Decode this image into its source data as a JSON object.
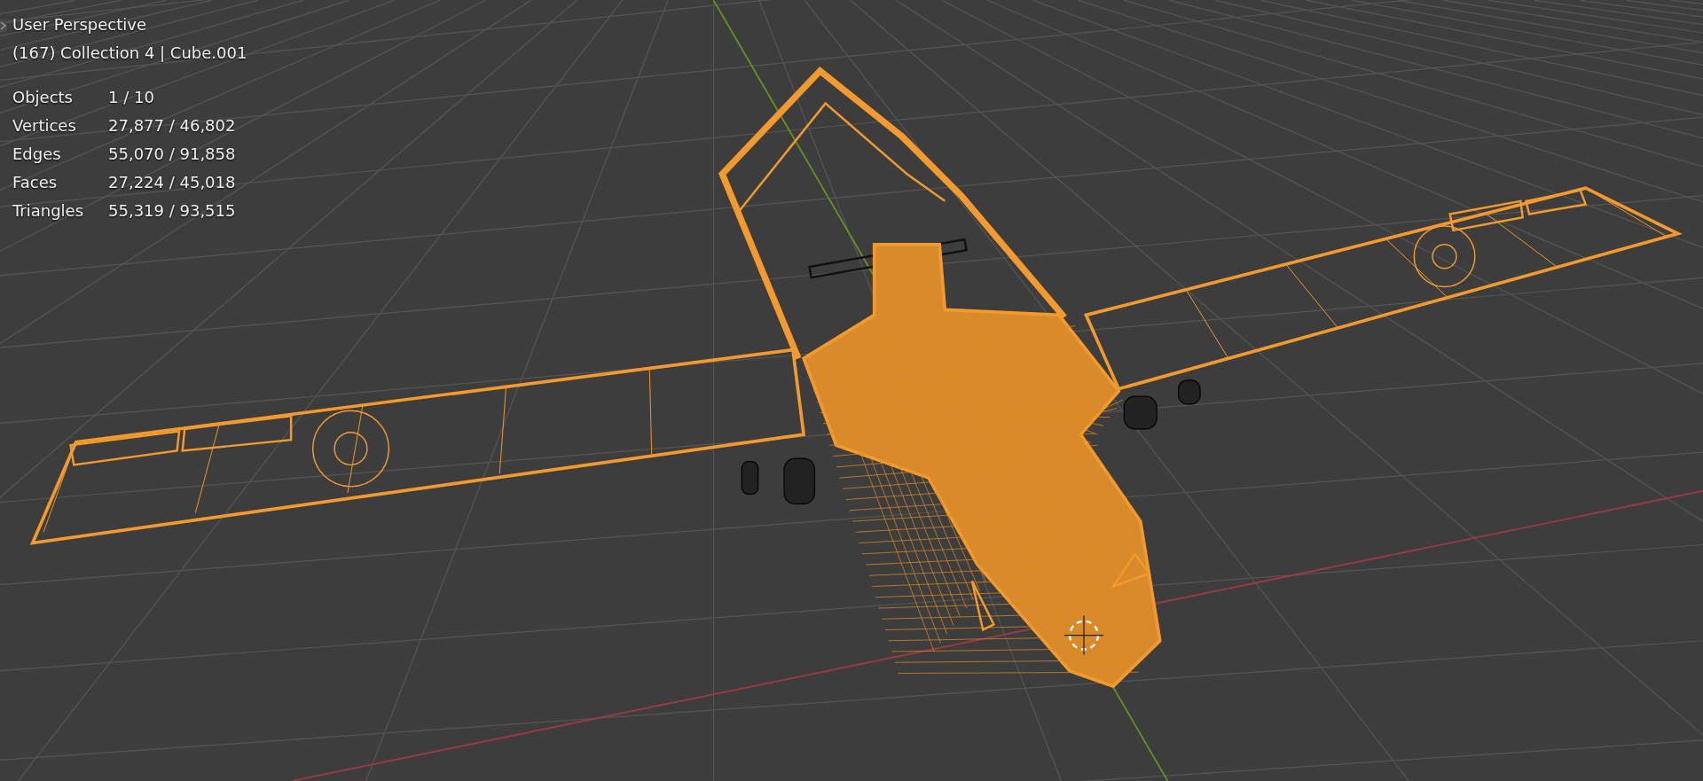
{
  "viewport": {
    "view_name": "User Perspective",
    "context": "(167) Collection 4 | Cube.001",
    "stats": [
      {
        "label": "Objects",
        "value": "1 / 10"
      },
      {
        "label": "Vertices",
        "value": "27,877 / 46,802"
      },
      {
        "label": "Edges",
        "value": "55,070 / 91,858"
      },
      {
        "label": "Faces",
        "value": "27,224 / 45,018"
      },
      {
        "label": "Triangles",
        "value": "55,319 / 93,515"
      }
    ]
  }
}
